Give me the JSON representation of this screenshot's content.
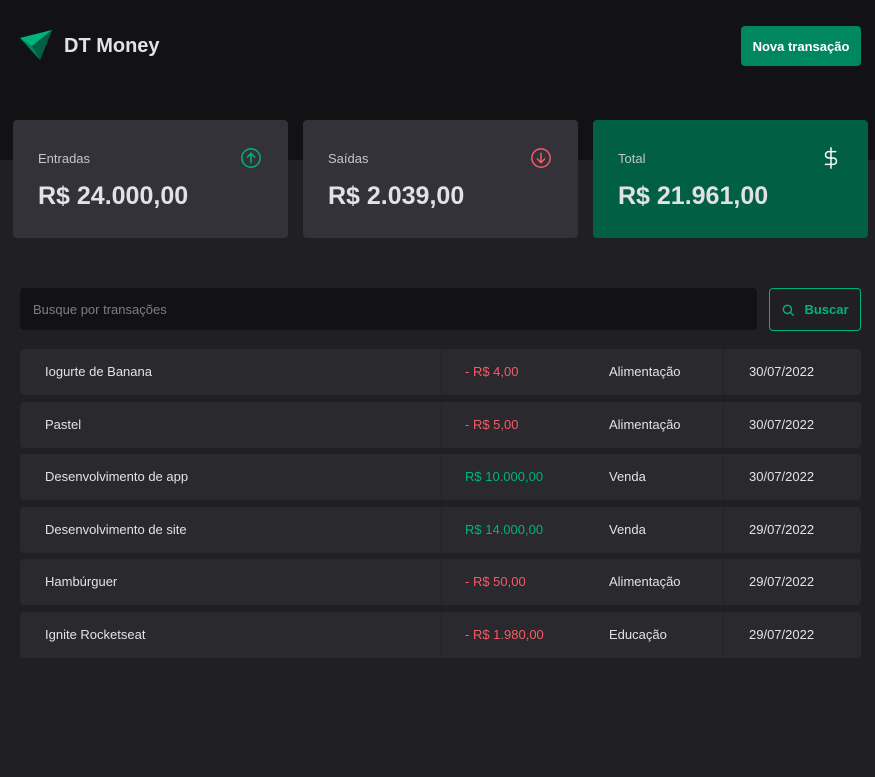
{
  "header": {
    "logo_text": "DT Money",
    "new_transaction_label": "Nova transação"
  },
  "summary": [
    {
      "label": "Entradas",
      "value": "R$ 24.000,00",
      "icon": "arrow-circle-up-icon",
      "color": "#00b37e"
    },
    {
      "label": "Saídas",
      "value": "R$ 2.039,00",
      "icon": "arrow-circle-down-icon",
      "color": "#f75a68"
    },
    {
      "label": "Total",
      "value": "R$ 21.961,00",
      "icon": "dollar-icon",
      "color": "#ffffff"
    }
  ],
  "search": {
    "placeholder": "Busque por transações",
    "value": "",
    "button_label": "Buscar"
  },
  "transactions": [
    {
      "description": "Iogurte de Banana",
      "price": "- R$ 4,00",
      "type": "outcome",
      "category": "Alimentação",
      "date": "30/07/2022"
    },
    {
      "description": "Pastel",
      "price": "- R$ 5,00",
      "type": "outcome",
      "category": "Alimentação",
      "date": "30/07/2022"
    },
    {
      "description": "Desenvolvimento de app",
      "price": "R$ 10.000,00",
      "type": "income",
      "category": "Venda",
      "date": "30/07/2022"
    },
    {
      "description": "Desenvolvimento de site",
      "price": "R$ 14.000,00",
      "type": "income",
      "category": "Venda",
      "date": "29/07/2022"
    },
    {
      "description": "Hambúrguer",
      "price": "- R$ 50,00",
      "type": "outcome",
      "category": "Alimentação",
      "date": "29/07/2022"
    },
    {
      "description": "Ignite Rocketseat",
      "price": "- R$ 1.980,00",
      "type": "outcome",
      "category": "Educação",
      "date": "29/07/2022"
    }
  ],
  "colors": {
    "brand": "#00875f",
    "income": "#00b37e",
    "outcome": "#f75a68",
    "background": "#202024",
    "header": "#121214"
  }
}
